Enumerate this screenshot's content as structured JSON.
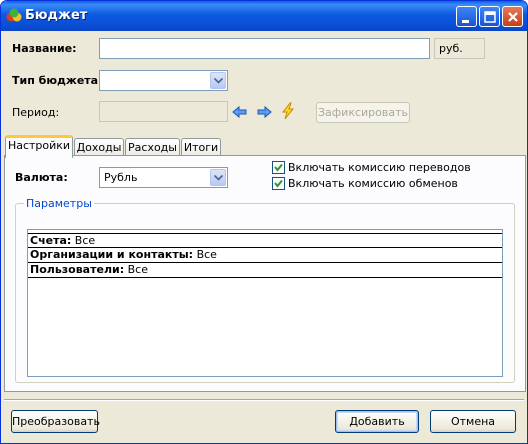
{
  "window": {
    "title": "Бюджет"
  },
  "form": {
    "name_label": "Название:",
    "name_value": "",
    "currency_hint": "руб.",
    "budget_type_label": "Тип бюджета:",
    "budget_type_value": "",
    "period_label": "Период:",
    "period_value": "",
    "fix_button": "Зафиксировать"
  },
  "tabs": [
    {
      "label": "Настройки",
      "active": true
    },
    {
      "label": "Доходы",
      "active": false
    },
    {
      "label": "Расходы",
      "active": false
    },
    {
      "label": "Итоги",
      "active": false
    }
  ],
  "settings": {
    "currency_label": "Валюта:",
    "currency_value": "Рубль",
    "include_transfer_fee": {
      "label": "Включать комиссию переводов",
      "checked": true
    },
    "include_exchange_fee": {
      "label": "Включать комиссию обменов",
      "checked": true
    },
    "params_group_title": "Параметры",
    "params": [
      {
        "key": "Счета:",
        "value": "Все"
      },
      {
        "key": "Организации и контакты:",
        "value": "Все"
      },
      {
        "key": "Пользователи:",
        "value": "Все"
      }
    ]
  },
  "footer": {
    "convert_button": "Преобразовать",
    "add_button": "Добавить",
    "cancel_button": "Отмена"
  },
  "colors": {
    "title_bar": "#0a5fe6",
    "window_bg": "#ece9d8",
    "tab_accent": "#ffc83c",
    "group_title": "#0046d5"
  },
  "icons": [
    "app-budget-icon",
    "minimize-icon",
    "maximize-icon",
    "close-icon",
    "arrow-left-icon",
    "arrow-right-icon",
    "lightning-icon",
    "chevron-down-icon",
    "checkmark-icon"
  ]
}
